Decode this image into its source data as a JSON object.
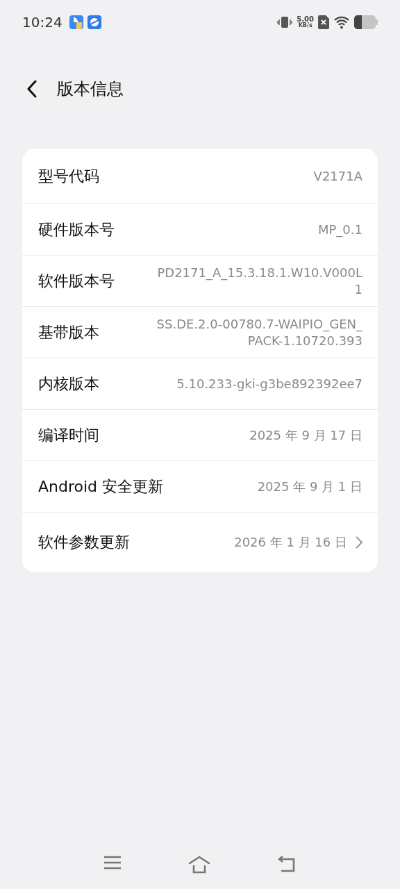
{
  "status_bar": {
    "time": "10:24",
    "speed_value": "5.00",
    "speed_unit": "KB/s"
  },
  "header": {
    "title": "版本信息"
  },
  "rows": [
    {
      "label": "型号代码",
      "value": "V2171A",
      "kind": "info"
    },
    {
      "label": "硬件版本号",
      "value": "MP_0.1",
      "kind": "info"
    },
    {
      "label": "软件版本号",
      "value": "PD2171_A_15.3.18.1.W10.V000L1",
      "kind": "info"
    },
    {
      "label": "基带版本",
      "value": "SS.DE.2.0-00780.7-WAIPIO_GEN_PACK-1.10720.393",
      "kind": "info"
    },
    {
      "label": "内核版本",
      "value": "5.10.233-gki-g3be892392ee7",
      "kind": "info"
    },
    {
      "label": "编译时间",
      "value": "2025 年 9 月 17 日",
      "kind": "info"
    },
    {
      "label": "Android 安全更新",
      "value": "2025 年 9 月 1 日",
      "kind": "info"
    },
    {
      "label": "软件参数更新",
      "value": "2026 年 1 月 16 日",
      "kind": "link"
    }
  ]
}
